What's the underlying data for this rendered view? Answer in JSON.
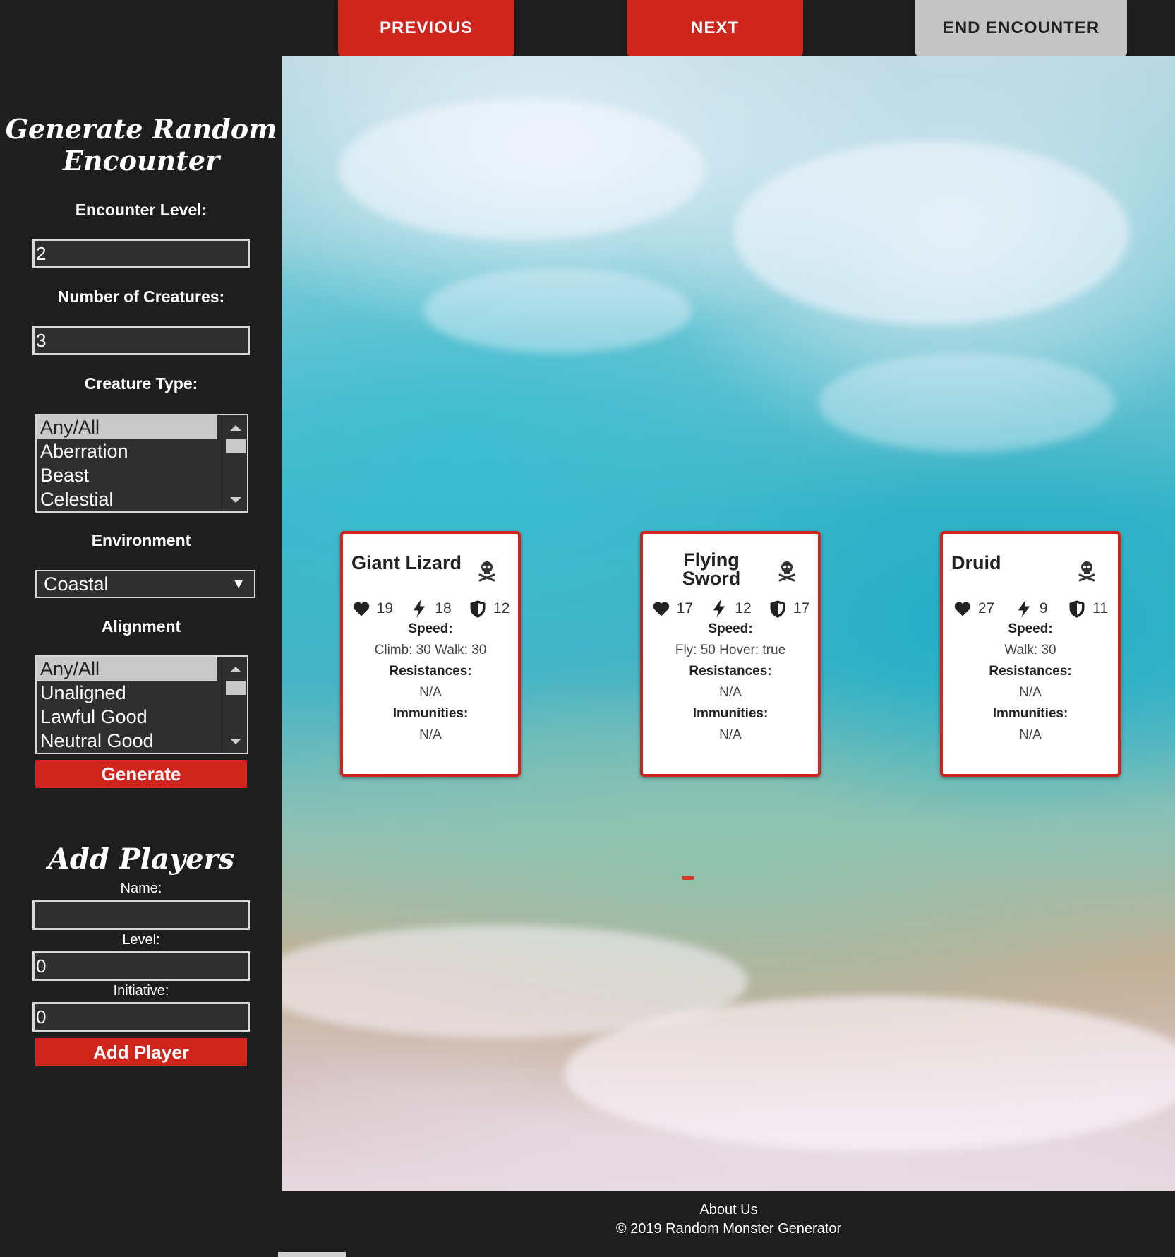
{
  "topbar": {
    "previous_label": "PREVIOUS",
    "next_label": "NEXT",
    "end_label": "END ENCOUNTER"
  },
  "sidebar": {
    "generate_title_line1": "Generate Random",
    "generate_title_line2": "Encounter",
    "encounter_level_label": "Encounter Level:",
    "encounter_level_value": "2",
    "num_creatures_label": "Number of Creatures:",
    "num_creatures_value": "3",
    "creature_type_label": "Creature Type:",
    "creature_types": [
      "Any/All",
      "Aberration",
      "Beast",
      "Celestial"
    ],
    "creature_type_selected": "Any/All",
    "environment_label": "Environment",
    "environment_value": "Coastal",
    "alignment_label": "Alignment",
    "alignments": [
      "Any/All",
      "Unaligned",
      "Lawful Good",
      "Neutral Good"
    ],
    "alignment_selected": "Any/All",
    "generate_button": "Generate",
    "add_players_title": "Add Players",
    "name_label": "Name:",
    "name_value": "",
    "level_label": "Level:",
    "level_value": "0",
    "initiative_label": "Initiative:",
    "initiative_value": "0",
    "add_player_button": "Add Player"
  },
  "cards": [
    {
      "name": "Giant Lizard",
      "hp": "19",
      "initiative": "18",
      "ac": "12",
      "speed_label": "Speed:",
      "speed": "Climb: 30 Walk: 30",
      "resistances_label": "Resistances:",
      "resistances": "N/A",
      "immunities_label": "Immunities:",
      "immunities": "N/A"
    },
    {
      "name_line1": "Flying",
      "name_line2": "Sword",
      "hp": "17",
      "initiative": "12",
      "ac": "17",
      "speed_label": "Speed:",
      "speed": "Fly: 50 Hover: true",
      "resistances_label": "Resistances:",
      "resistances": "N/A",
      "immunities_label": "Immunities:",
      "immunities": "N/A"
    },
    {
      "name": "Druid",
      "hp": "27",
      "initiative": "9",
      "ac": "11",
      "speed_label": "Speed:",
      "speed": "Walk: 30",
      "resistances_label": "Resistances:",
      "resistances": "N/A",
      "immunities_label": "Immunities:",
      "immunities": "N/A"
    }
  ],
  "icons": {
    "hp": "heart-icon",
    "initiative": "lightning-icon",
    "ac": "shield-icon",
    "remove": "skull-icon"
  },
  "footer": {
    "about_label": "About Us",
    "copyright": "© 2019 Random Monster Generator"
  },
  "colors": {
    "accent": "#d0251c",
    "background": "#1e1e1e",
    "end_button": "#c4c4c4"
  }
}
